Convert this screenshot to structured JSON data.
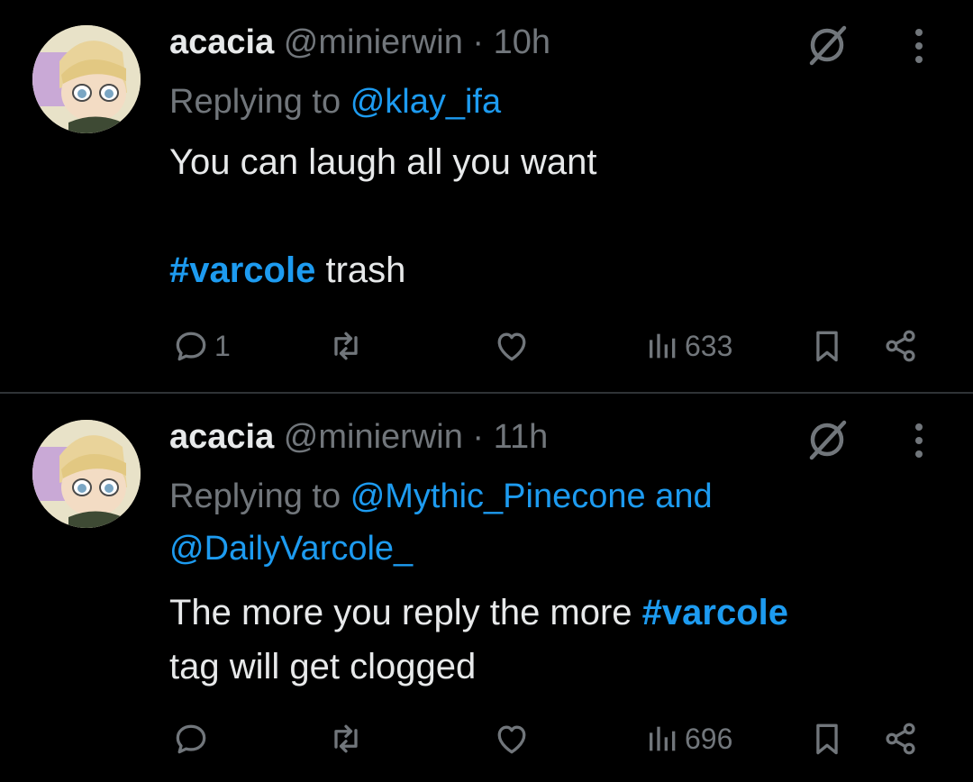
{
  "colors": {
    "background": "#000000",
    "text": "#e7e9ea",
    "secondary": "#71767b",
    "link": "#1d9bf0",
    "divider": "#2f3336"
  },
  "tweets": [
    {
      "display_name": "acacia",
      "handle": "@minierwin",
      "separator": "·",
      "time": "10h",
      "replying_prefix": "Replying to",
      "mentions": [
        "@klay_ifa"
      ],
      "mention_joiner": "",
      "body": {
        "line1": "You can laugh all you want",
        "hashtag": "#varcole",
        "after_hashtag": " trash"
      },
      "actions": {
        "replies": "1",
        "retweets": "",
        "likes": "",
        "views": "633"
      },
      "icons": [
        "grok-icon",
        "more-icon",
        "reply-icon",
        "retweet-icon",
        "like-icon",
        "views-icon",
        "bookmark-icon",
        "share-icon"
      ]
    },
    {
      "display_name": "acacia",
      "handle": "@minierwin",
      "separator": "·",
      "time": "11h",
      "replying_prefix": "Replying to",
      "mentions": [
        "@Mythic_Pinecone",
        "@DailyVarcole_"
      ],
      "mention_joiner": "and",
      "body": {
        "before_hashtag": "The more you reply the more ",
        "hashtag": "#varcole",
        "after_hashtag": "tag will get clogged"
      },
      "actions": {
        "replies": "",
        "retweets": "",
        "likes": "",
        "views": "696"
      },
      "icons": [
        "grok-icon",
        "more-icon",
        "reply-icon",
        "retweet-icon",
        "like-icon",
        "views-icon",
        "bookmark-icon",
        "share-icon"
      ]
    }
  ]
}
